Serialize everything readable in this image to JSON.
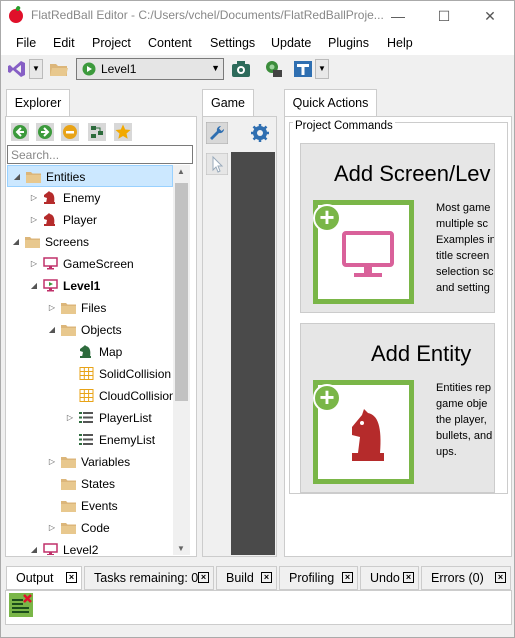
{
  "window": {
    "title": "FlatRedBall Editor - C:/Users/vchel/Documents/FlatRedBallProje...",
    "minimize": "—",
    "maximize": "☐",
    "close": "✕"
  },
  "menu": [
    "File",
    "Edit",
    "Project",
    "Content",
    "Settings",
    "Update",
    "Plugins",
    "Help"
  ],
  "toolbar": {
    "screen_combo_value": "Level1"
  },
  "explorer": {
    "tab": "Explorer",
    "search_placeholder": "Search...",
    "tree": [
      {
        "label": "Entities",
        "level": 0,
        "expander": "open",
        "icon": "folder-icon",
        "selected": true
      },
      {
        "label": "Enemy",
        "level": 1,
        "expander": "closed",
        "icon": "knight-icon"
      },
      {
        "label": "Player",
        "level": 1,
        "expander": "closed",
        "icon": "knight-icon"
      },
      {
        "label": "Screens",
        "level": 0,
        "expander": "open",
        "icon": "folder-icon"
      },
      {
        "label": "GameScreen",
        "level": 1,
        "expander": "closed",
        "icon": "monitor-icon"
      },
      {
        "label": "Level1",
        "level": 1,
        "expander": "open",
        "icon": "monitor-play-icon",
        "bold": true
      },
      {
        "label": "Files",
        "level": 2,
        "expander": "closed",
        "icon": "folder-icon"
      },
      {
        "label": "Objects",
        "level": 2,
        "expander": "open",
        "icon": "folder-icon"
      },
      {
        "label": "Map",
        "level": 3,
        "expander": "",
        "icon": "green-knight-icon"
      },
      {
        "label": "SolidCollision",
        "level": 3,
        "expander": "",
        "icon": "grid-icon"
      },
      {
        "label": "CloudCollision",
        "level": 3,
        "expander": "",
        "icon": "grid-icon"
      },
      {
        "label": "PlayerList",
        "level": 3,
        "expander": "closed",
        "icon": "list-icon"
      },
      {
        "label": "EnemyList",
        "level": 3,
        "expander": "",
        "icon": "list-icon"
      },
      {
        "label": "Variables",
        "level": 2,
        "expander": "closed",
        "icon": "folder-icon"
      },
      {
        "label": "States",
        "level": 2,
        "expander": "",
        "icon": "folder-icon"
      },
      {
        "label": "Events",
        "level": 2,
        "expander": "",
        "icon": "folder-icon"
      },
      {
        "label": "Code",
        "level": 2,
        "expander": "closed",
        "icon": "folder-icon"
      },
      {
        "label": "Level2",
        "level": 1,
        "expander": "open",
        "icon": "monitor-icon"
      }
    ]
  },
  "game_tab": "Game",
  "quick_actions": {
    "tab": "Quick Actions",
    "group_title": "Project Commands",
    "cards": [
      {
        "title": "Add Screen/Lev",
        "desc": "Most game\nmultiple sc\nExamples in\ntitle screen\nselection sc\nand setting"
      },
      {
        "title": "Add Entity",
        "desc": "Entities rep\ngame obje\nthe player,\nbullets, and\nups."
      }
    ]
  },
  "bottom_tabs": [
    "Output",
    "Tasks remaining: 0",
    "Build",
    "Profiling",
    "Undo",
    "Errors (0)"
  ],
  "colors": {
    "accent_green": "#7ab648",
    "entity_red": "#b52b2b",
    "screen_pink": "#d9619a",
    "selection": "#cce8ff"
  }
}
